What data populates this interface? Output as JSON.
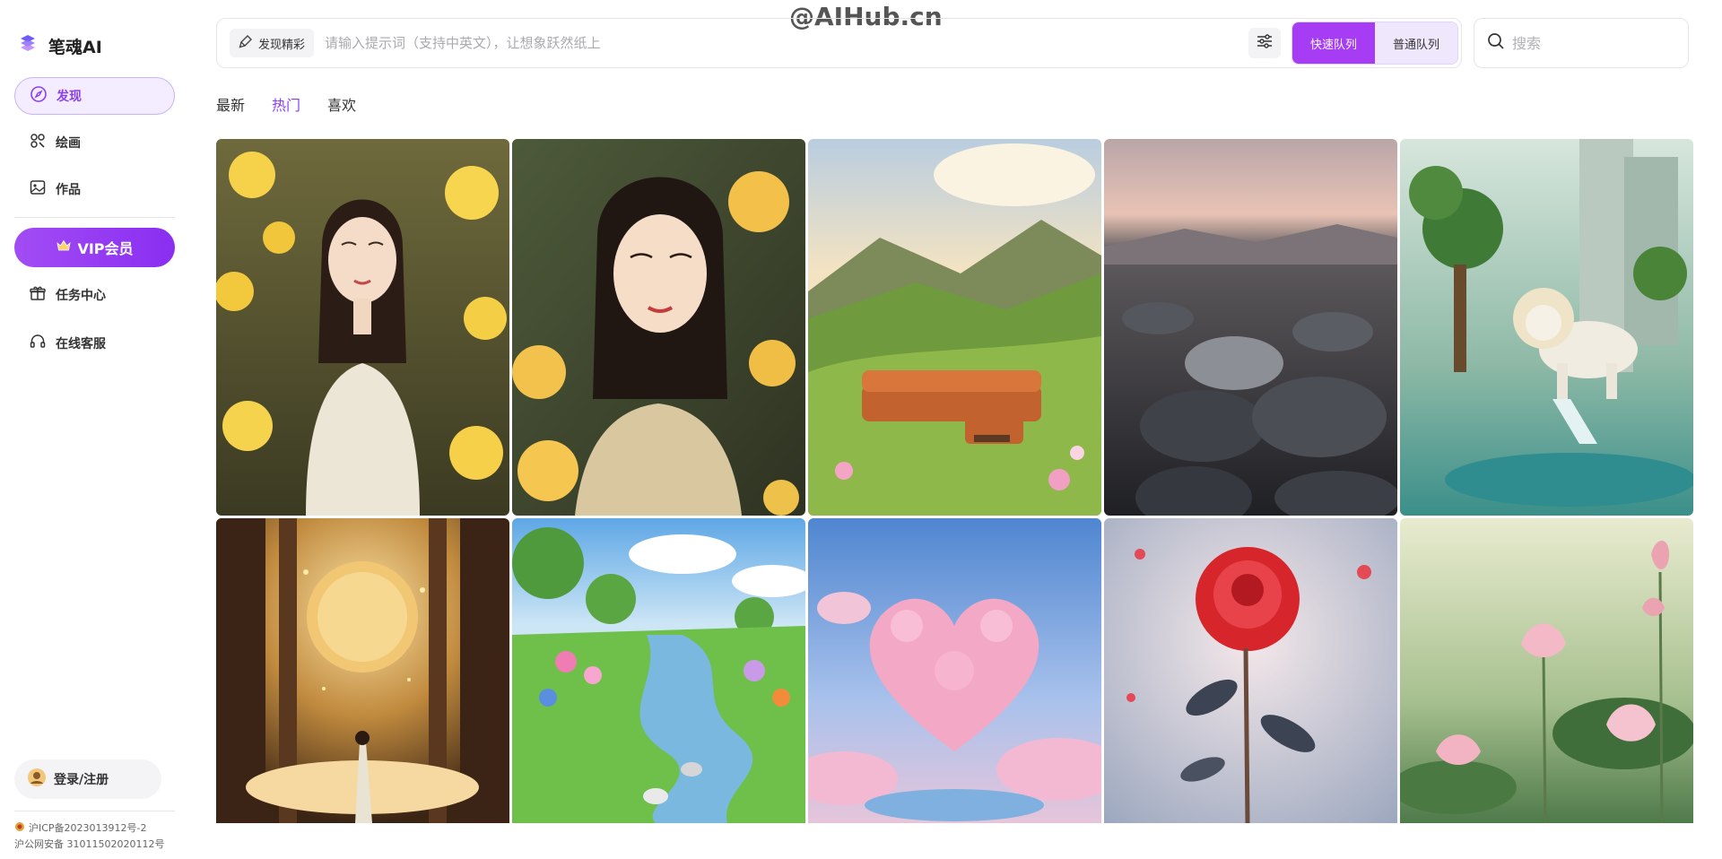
{
  "brand": {
    "name": "笔魂AI"
  },
  "watermark": "@AIHub.cn",
  "nav": {
    "items": [
      {
        "label": "发现"
      },
      {
        "label": "绘画"
      },
      {
        "label": "作品"
      }
    ],
    "vip_label": "VIP会员",
    "items2": [
      {
        "label": "任务中心"
      },
      {
        "label": "在线客服"
      }
    ],
    "login_label": "登录/注册"
  },
  "footer": {
    "icp": "沪ICP备2023013912号-2",
    "police": "沪公网安备 31011502020112号"
  },
  "topbar": {
    "chip_label": "发现精彩",
    "prompt_placeholder": "请输入提示词（支持中英文），让想象跃然纸上",
    "fast_queue": "快速队列",
    "normal_queue": "普通队列",
    "search_placeholder": "搜索"
  },
  "tabs": [
    {
      "label": "最新"
    },
    {
      "label": "热门"
    },
    {
      "label": "喜欢"
    }
  ],
  "colors": {
    "accent": "#8b3ff0",
    "vip_gradient_start": "#a24cf5",
    "vip_gradient_end": "#8a2ef0",
    "fast_queue_bg": "#a73cf5"
  },
  "gallery": [
    {
      "subject": "woman with yellow roses"
    },
    {
      "subject": "woman portrait with yellow roses"
    },
    {
      "subject": "orange sofa in green valley"
    },
    {
      "subject": "pebbles at dusk"
    },
    {
      "subject": "white lion by waterfall"
    },
    {
      "subject": "figure before golden moon"
    },
    {
      "subject": "stream through flower meadow"
    },
    {
      "subject": "pink cloud heart"
    },
    {
      "subject": "crystal red rose"
    },
    {
      "subject": "pink lotus flowers"
    }
  ]
}
